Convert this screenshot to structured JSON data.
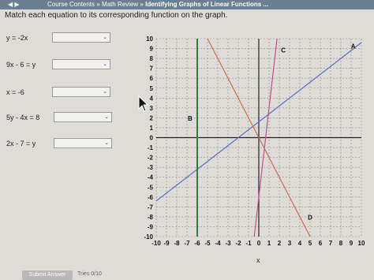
{
  "header": {
    "breadcrumb_course": "Course Contents",
    "separator1": " » ",
    "breadcrumb_review": "Math Review",
    "separator2": " » ",
    "page_title": "Identifying Graphs of Linear Functions ..."
  },
  "instruction": "Match each equation to its corresponding function on the graph.",
  "equations": [
    {
      "label": "y = -2x",
      "value": ""
    },
    {
      "label": "9x - 6 = y",
      "value": ""
    },
    {
      "label": "x = -6",
      "value": ""
    },
    {
      "label": "5y - 4x = 8",
      "value": ""
    },
    {
      "label": "2x - 7 = y",
      "value": ""
    }
  ],
  "footer": {
    "submit_label": "Submit Answer",
    "tries_label": "Tries 0/10"
  },
  "colors": {
    "line_A": "#5a6cc9",
    "line_B": "#2f7d3a",
    "line_C": "#c44d8f",
    "line_D": "#d06a5a",
    "grid": "#8f8f8f"
  },
  "chart_data": {
    "type": "line",
    "xlabel": "x",
    "ylabel": "",
    "xlim": [
      -10,
      10
    ],
    "ylim": [
      -10,
      10
    ],
    "x_ticks": [
      "-10",
      "-9",
      "-8",
      "-7",
      "-6",
      "-5",
      "-4",
      "-3",
      "-2",
      "-1",
      "0",
      "1",
      "2",
      "3",
      "4",
      "5",
      "6",
      "7",
      "8",
      "9",
      "10"
    ],
    "y_ticks": [
      "10",
      "9",
      "8",
      "7",
      "6",
      "5",
      "4",
      "3",
      "2",
      "1",
      "0",
      "-1",
      "-2",
      "-3",
      "-4",
      "-5",
      "-6",
      "-7",
      "-8",
      "-9",
      "-10"
    ],
    "grid": true,
    "lines": [
      {
        "label": "A",
        "slope": 0.8,
        "intercept": 1.6
      },
      {
        "label": "B",
        "vertical_x": -6
      },
      {
        "label": "C",
        "slope": 9,
        "intercept": -6
      },
      {
        "label": "D",
        "slope": -2,
        "intercept": 0
      }
    ],
    "label_positions": [
      {
        "label": "A",
        "x": 9.2,
        "y": 9.0
      },
      {
        "label": "B",
        "x": -6.7,
        "y": 1.7
      },
      {
        "label": "C",
        "x": 2.4,
        "y": 8.6
      },
      {
        "label": "D",
        "x": 5.0,
        "y": -8.3
      }
    ]
  }
}
